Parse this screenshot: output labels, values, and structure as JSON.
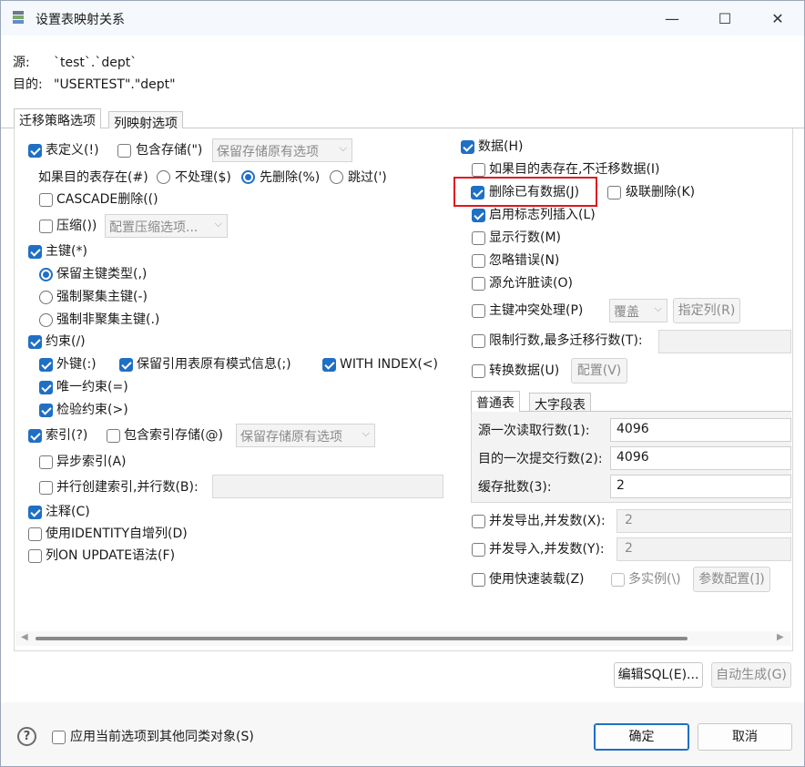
{
  "window": {
    "title": "设置表映射关系",
    "min": "—",
    "max": "☐",
    "close": "✕"
  },
  "header": {
    "source_label": "源:",
    "source_value": "`test`.`dept`",
    "target_label": "目的:",
    "target_value": "\"USERTEST\".\"dept\""
  },
  "tabs": [
    "迁移策略选项",
    "列映射选项"
  ],
  "left": {
    "table_def": "表定义(!)",
    "include_storage": "包含存储(\")",
    "storage_option": "保留存储原有选项",
    "if_exists": "如果目的表存在(#)",
    "r_none": "不处理($)",
    "r_drop": "先删除(%)",
    "r_skip": "跳过(')",
    "cascade": "CASCADE删除(()",
    "compress": "压缩())",
    "compress_option": "配置压缩选项...",
    "pk": "主键(*)",
    "pk_keep": "保留主键类型(,)",
    "pk_clustered": "强制聚集主键(-)",
    "pk_nonclustered": "强制非聚集主键(.)",
    "constraint": "约束(/)",
    "fk": "外键(:)",
    "keep_ref": "保留引用表原有模式信息(;)",
    "with_index": "WITH INDEX(<)",
    "unique": "唯一约束(=)",
    "check": "检验约束(>)",
    "index": "索引(?)",
    "include_index_storage": "包含索引存储(@)",
    "index_storage_option": "保留存储原有选项",
    "async_index": "异步索引(A)",
    "parallel_index": "并行创建索引,并行数(B):",
    "comment": "注释(C)",
    "identity": "使用IDENTITY自增列(D)",
    "on_update": "列ON UPDATE语法(F)"
  },
  "right": {
    "data": "数据(H)",
    "no_migrate": "如果目的表存在,不迁移数据(I)",
    "delete_existing": "删除已有数据(J)",
    "cascade_delete": "级联删除(K)",
    "identity_insert": "启用标志列插入(L)",
    "show_rows": "显示行数(M)",
    "ignore_errors": "忽略错误(N)",
    "dirty_read": "源允许脏读(O)",
    "pk_conflict": "主键冲突处理(P)",
    "pk_conflict_option": "覆盖",
    "specify_cols": "指定列(R)",
    "limit_rows": "限制行数,最多迁移行数(T):",
    "convert": "转换数据(U)",
    "configure": "配置(V)",
    "subtabs": [
      "普通表",
      "大字段表"
    ],
    "read_rows_label": "源一次读取行数(1):",
    "read_rows": "4096",
    "commit_rows_label": "目的一次提交行数(2):",
    "commit_rows": "4096",
    "batch_label": "缓存批数(3):",
    "batch": "2",
    "par_export": "并发导出,并发数(X):",
    "par_export_val": "2",
    "par_import": "并发导入,并发数(Y):",
    "par_import_val": "2",
    "fast_load": "使用快速装载(Z)",
    "multi_instance": "多实例(\\)",
    "param_config": "参数配置(])"
  },
  "buttons": {
    "edit_sql": "编辑SQL(E)...",
    "auto_generate": "自动生成(G)",
    "ok": "确定",
    "cancel": "取消"
  },
  "footer": {
    "apply_all": "应用当前选项到其他同类对象(S)",
    "help": "?"
  },
  "colors": {
    "accent": "#1f6fc5",
    "highlight": "#e0161b"
  }
}
